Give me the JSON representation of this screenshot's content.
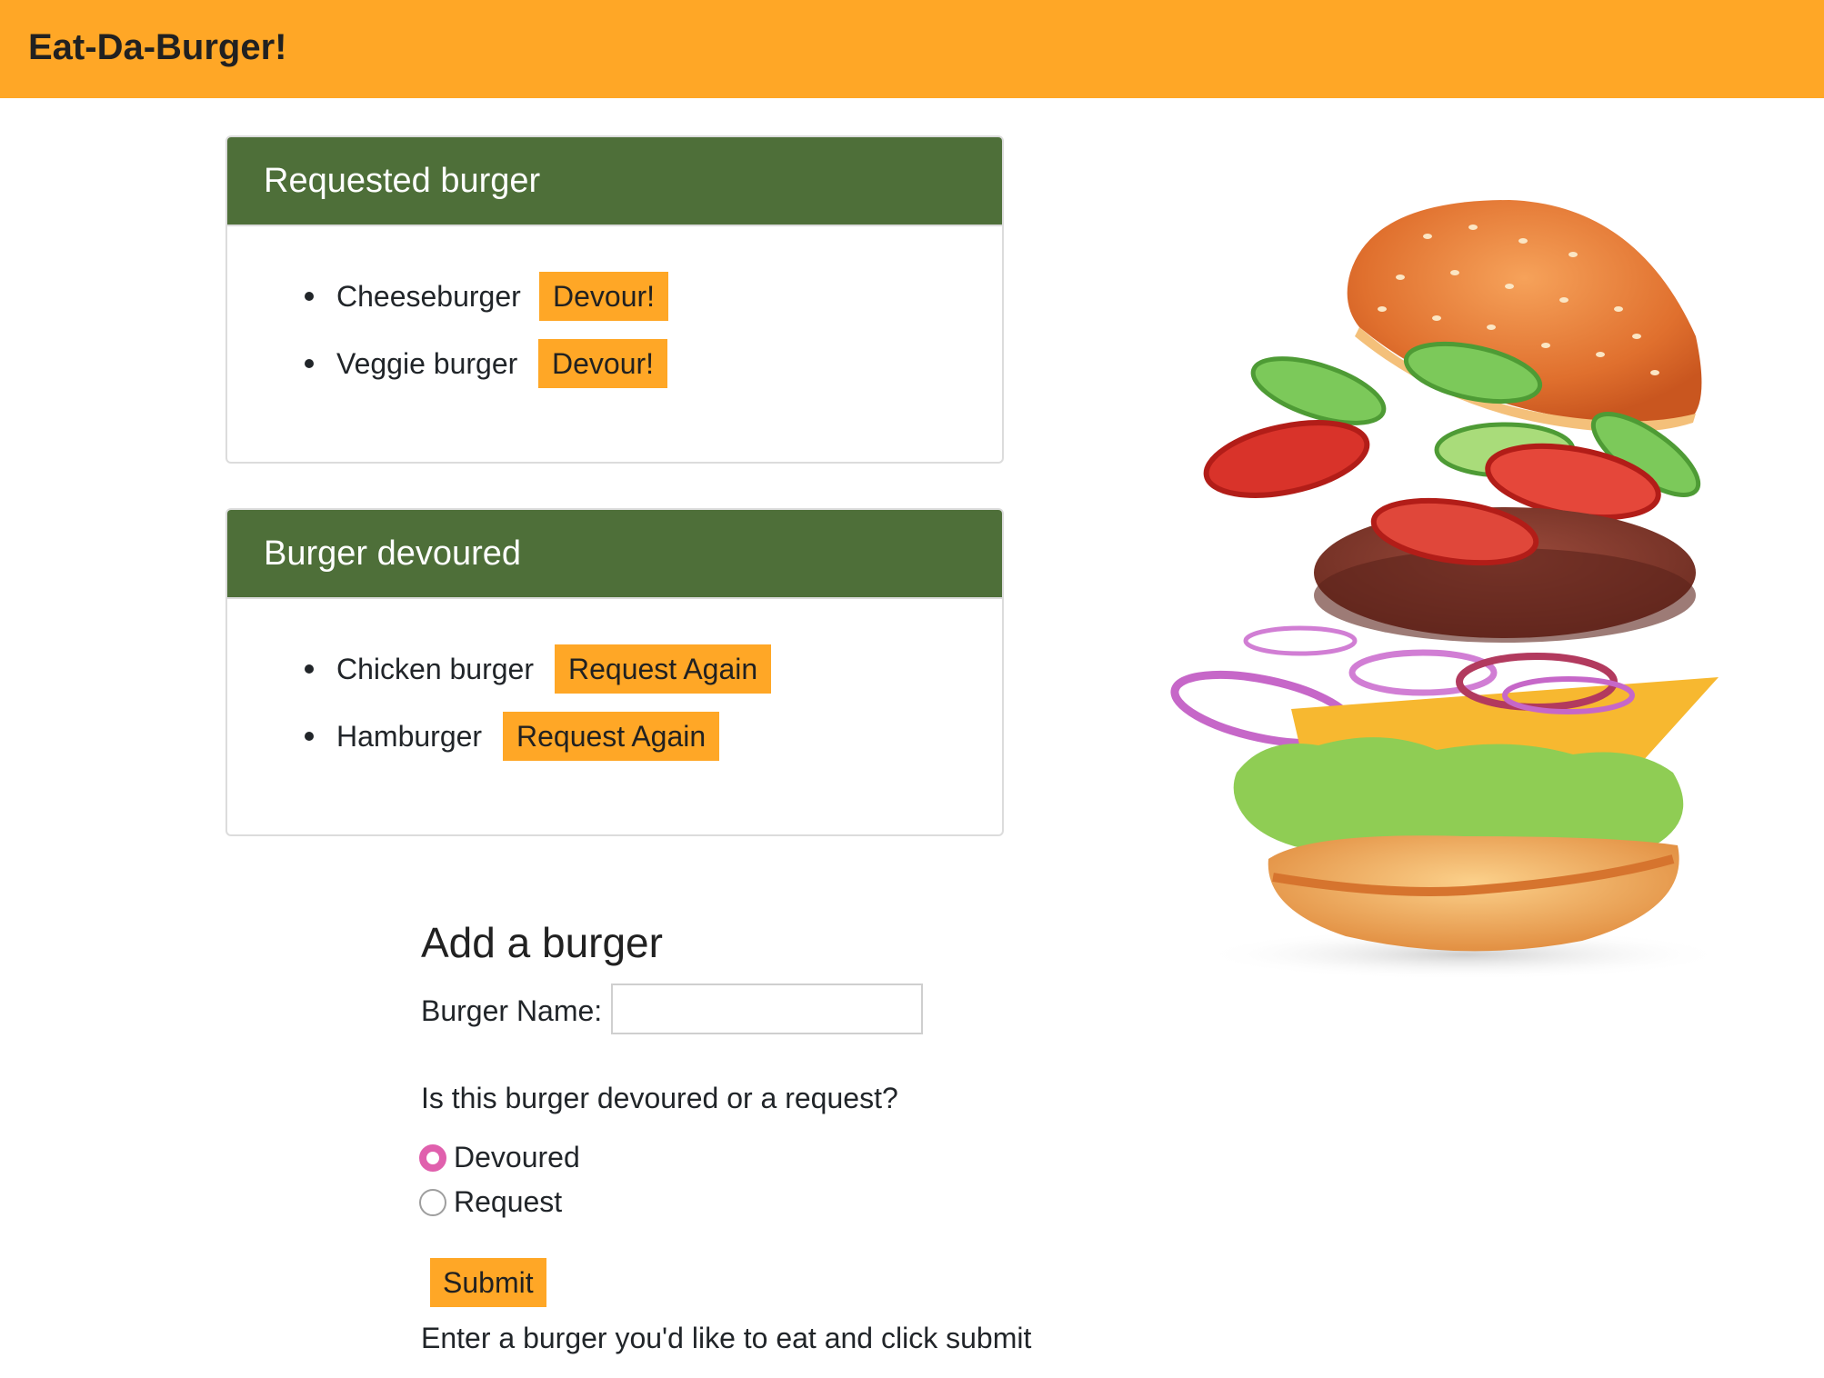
{
  "header": {
    "brand": "Eat-Da-Burger!"
  },
  "requested_card": {
    "title": "Requested burger",
    "items": [
      {
        "name": "Cheeseburger",
        "action": "Devour!"
      },
      {
        "name": "Veggie burger",
        "action": "Devour!"
      }
    ]
  },
  "devoured_card": {
    "title": "Burger devoured",
    "items": [
      {
        "name": "Chicken burger",
        "action": "Request Again"
      },
      {
        "name": "Hamburger",
        "action": "Request Again"
      }
    ]
  },
  "form": {
    "title": "Add a burger",
    "name_label": "Burger Name:",
    "name_value": "",
    "question": "Is this burger devoured or a request?",
    "options": [
      {
        "label": "Devoured",
        "checked": true
      },
      {
        "label": "Request",
        "checked": false
      }
    ],
    "submit_label": "Submit",
    "hint": "Enter a burger you'd like to eat and click submit"
  },
  "colors": {
    "accent": "#ffa726",
    "card_header": "#4e6f39",
    "radio_checked": "#e060ad"
  },
  "illustration": {
    "icon": "burger-illustration"
  }
}
